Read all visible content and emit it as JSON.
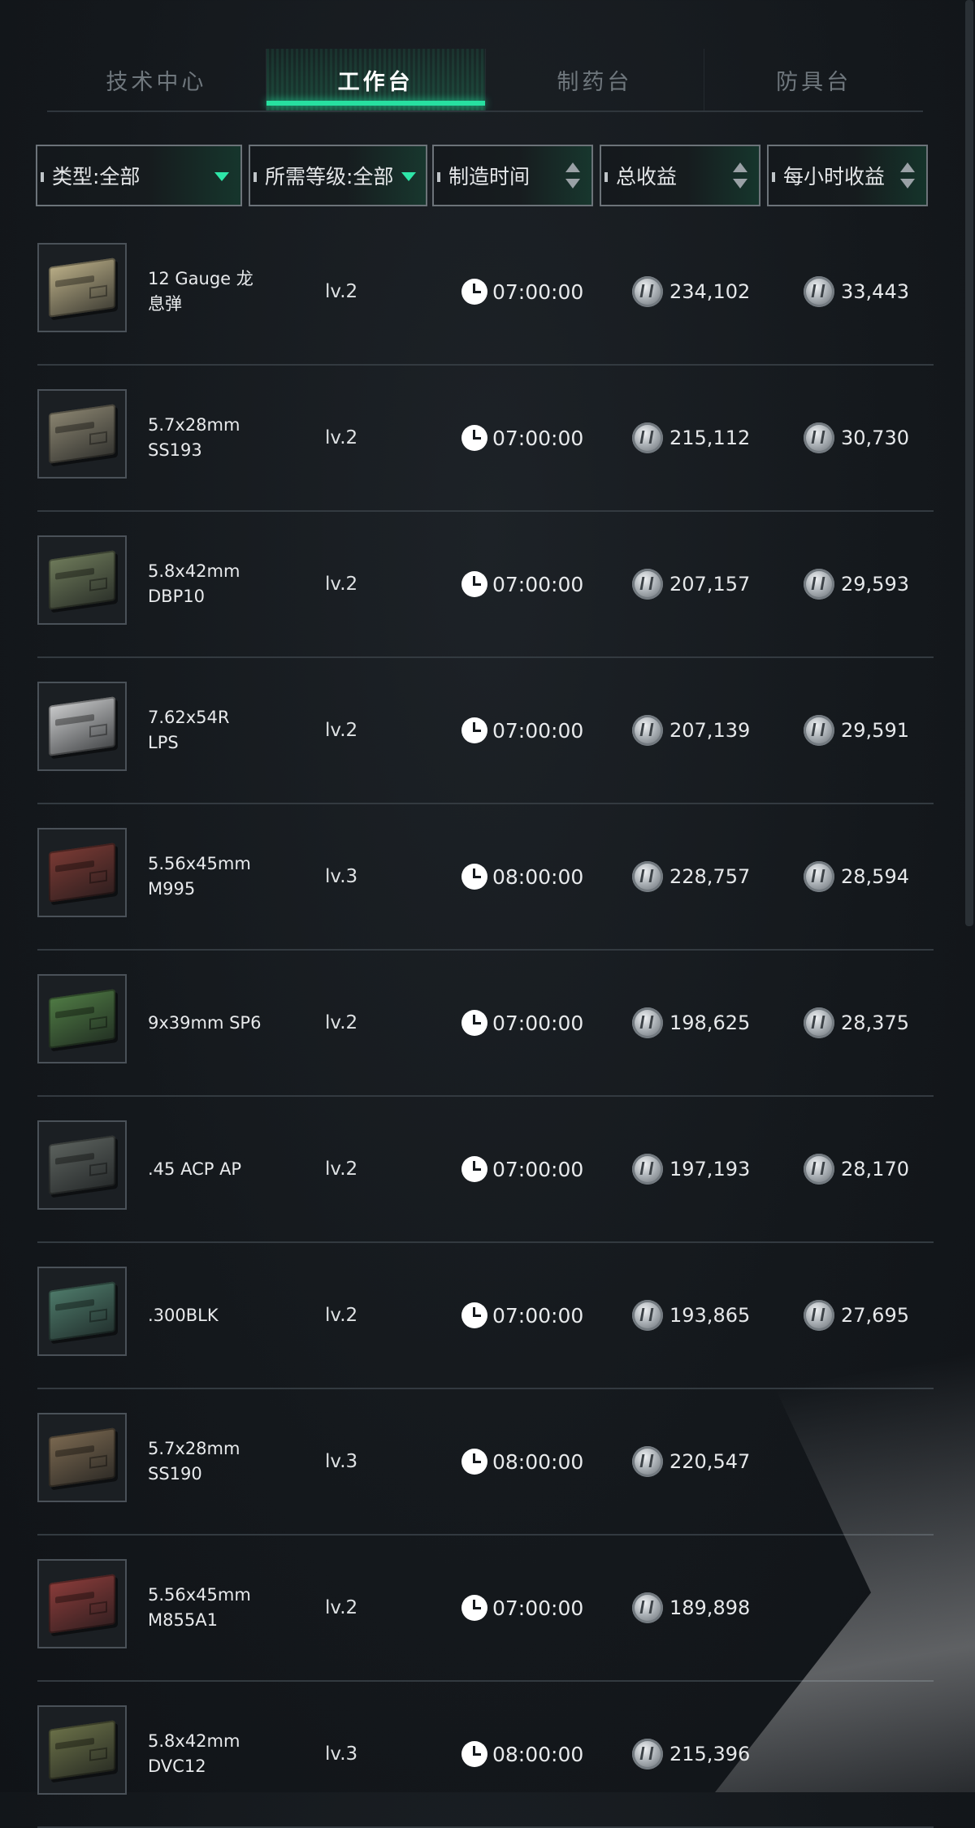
{
  "tabs": [
    {
      "label": "技术中心",
      "active": false
    },
    {
      "label": "工作台",
      "active": true
    },
    {
      "label": "制药台",
      "active": false
    },
    {
      "label": "防具台",
      "active": false
    }
  ],
  "filters": {
    "type": "类型:全部",
    "level": "所需等级:全部",
    "time": "制造时间",
    "total": "总收益",
    "hourly": "每小时收益"
  },
  "rows": [
    {
      "name1": "12 Gauge 龙",
      "name2": "息弹",
      "level": "lv.2",
      "time": "07:00:00",
      "total": "234,102",
      "hourly": "33,443",
      "box_color": "#b9ad86"
    },
    {
      "name1": "5.7x28mm",
      "name2": "SS193",
      "level": "lv.2",
      "time": "07:00:00",
      "total": "215,112",
      "hourly": "30,730",
      "box_color": "#8a8470"
    },
    {
      "name1": "5.8x42mm",
      "name2": "DBP10",
      "level": "lv.2",
      "time": "07:00:00",
      "total": "207,157",
      "hourly": "29,593",
      "box_color": "#6e7a5a"
    },
    {
      "name1": "7.62x54R",
      "name2": "LPS",
      "level": "lv.2",
      "time": "07:00:00",
      "total": "207,139",
      "hourly": "29,591",
      "box_color": "#c9cacb"
    },
    {
      "name1": "5.56x45mm",
      "name2": "M995",
      "level": "lv.3",
      "time": "08:00:00",
      "total": "228,757",
      "hourly": "28,594",
      "box_color": "#7a3a34"
    },
    {
      "name1": "9x39mm SP6",
      "name2": "",
      "level": "lv.2",
      "time": "07:00:00",
      "total": "198,625",
      "hourly": "28,375",
      "box_color": "#4f7a44"
    },
    {
      "name1": ".45 ACP AP",
      "name2": "",
      "level": "lv.2",
      "time": "07:00:00",
      "total": "197,193",
      "hourly": "28,170",
      "box_color": "#5c625e"
    },
    {
      "name1": ".300BLK",
      "name2": "",
      "level": "lv.2",
      "time": "07:00:00",
      "total": "193,865",
      "hourly": "27,695",
      "box_color": "#4e7a6a"
    },
    {
      "name1": "5.7x28mm",
      "name2": "SS190",
      "level": "lv.3",
      "time": "08:00:00",
      "total": "220,547",
      "hourly": "",
      "box_color": "#7a6850"
    },
    {
      "name1": "5.56x45mm",
      "name2": "M855A1",
      "level": "lv.2",
      "time": "07:00:00",
      "total": "189,898",
      "hourly": "",
      "box_color": "#8a3c3a"
    },
    {
      "name1": "5.8x42mm",
      "name2": "DVC12",
      "level": "lv.3",
      "time": "08:00:00",
      "total": "215,396",
      "hourly": "",
      "box_color": "#6a7048"
    }
  ],
  "icons": {
    "clock": "clock-icon",
    "coin": "currency-coin-icon"
  }
}
